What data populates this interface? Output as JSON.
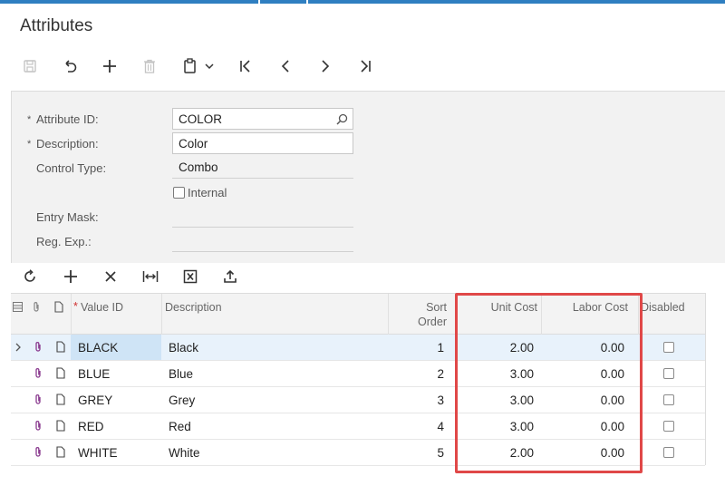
{
  "page": {
    "title": "Attributes"
  },
  "toolbar": {
    "buttons": [
      {
        "icon": "save-icon",
        "enabled": false
      },
      {
        "icon": "undo-icon",
        "enabled": true
      },
      {
        "icon": "add-icon",
        "enabled": true
      },
      {
        "icon": "delete-icon",
        "enabled": false
      },
      {
        "icon": "copy-paste-icon",
        "enabled": true
      },
      {
        "icon": "first-record-icon",
        "enabled": true
      },
      {
        "icon": "previous-record-icon",
        "enabled": true
      },
      {
        "icon": "next-record-icon",
        "enabled": true
      },
      {
        "icon": "last-record-icon",
        "enabled": true
      }
    ]
  },
  "form": {
    "attribute_id": {
      "label": "Attribute ID:",
      "value": "COLOR",
      "required": true
    },
    "description": {
      "label": "Description:",
      "value": "Color",
      "required": true
    },
    "control_type": {
      "label": "Control Type:",
      "value": "Combo"
    },
    "internal": {
      "label": "Internal",
      "checked": false
    },
    "entry_mask": {
      "label": "Entry Mask:",
      "value": ""
    },
    "reg_exp": {
      "label": "Reg. Exp.:",
      "value": ""
    },
    "required_mark": "*"
  },
  "grid": {
    "toolbar": [
      "refresh-icon",
      "add-row-icon",
      "delete-row-icon",
      "fit-columns-icon",
      "export-excel-icon",
      "upload-icon"
    ],
    "columns": {
      "value_id": "Value ID",
      "description": "Description",
      "sort_order_1": "Sort",
      "sort_order_2": "Order",
      "unit_cost": "Unit Cost",
      "labor_cost": "Labor Cost",
      "disabled": "Disabled"
    },
    "rows": [
      {
        "value_id": "BLACK",
        "description": "Black",
        "sort_order": "1",
        "unit_cost": "2.00",
        "labor_cost": "0.00",
        "disabled": false,
        "selected": true
      },
      {
        "value_id": "BLUE",
        "description": "Blue",
        "sort_order": "2",
        "unit_cost": "3.00",
        "labor_cost": "0.00",
        "disabled": false,
        "selected": false
      },
      {
        "value_id": "GREY",
        "description": "Grey",
        "sort_order": "3",
        "unit_cost": "3.00",
        "labor_cost": "0.00",
        "disabled": false,
        "selected": false
      },
      {
        "value_id": "RED",
        "description": "Red",
        "sort_order": "4",
        "unit_cost": "3.00",
        "labor_cost": "0.00",
        "disabled": false,
        "selected": false
      },
      {
        "value_id": "WHITE",
        "description": "White",
        "sort_order": "5",
        "unit_cost": "2.00",
        "labor_cost": "0.00",
        "disabled": false,
        "selected": false
      }
    ]
  },
  "colors": {
    "accent": "#2f7fc1",
    "highlight": "#e04848",
    "attachment": "#8a3b8f"
  }
}
